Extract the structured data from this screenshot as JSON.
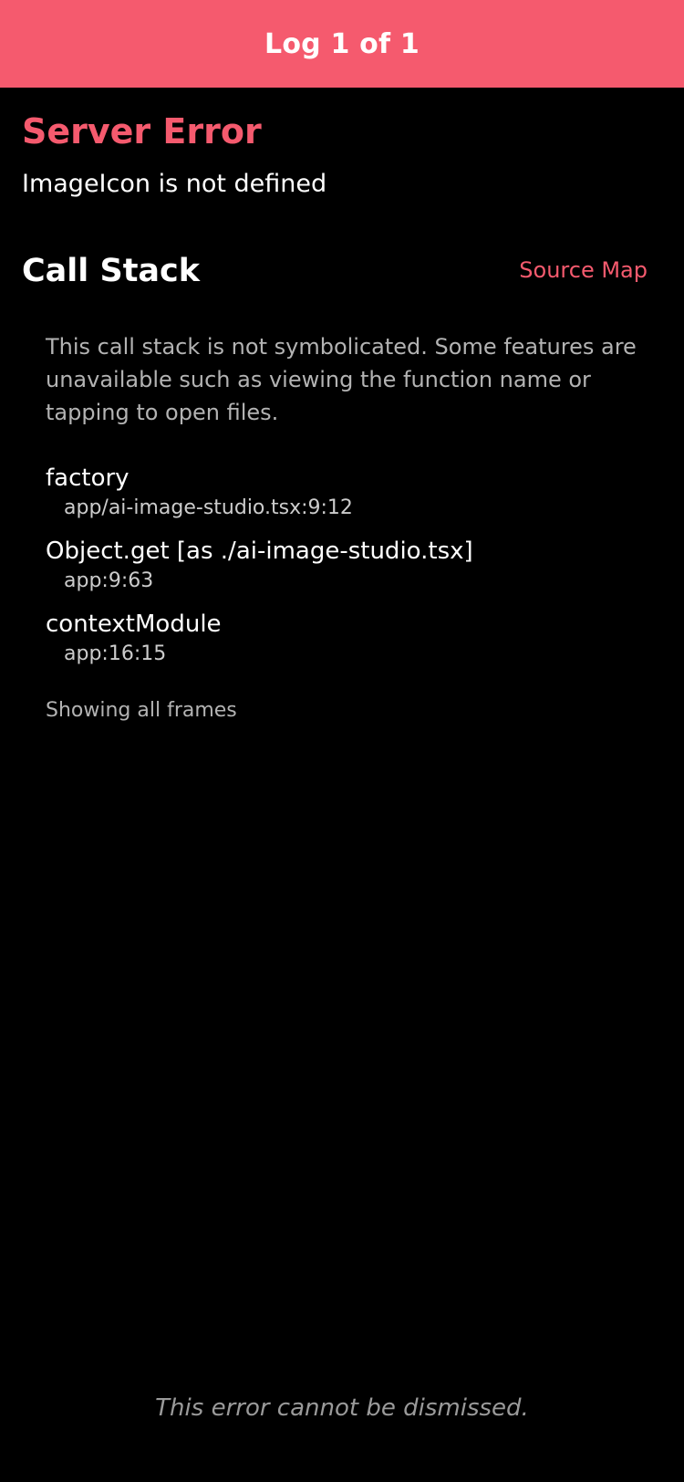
{
  "header": {
    "title": "Log 1 of 1",
    "background_color": "#F55A6E"
  },
  "error": {
    "title": "Server Error",
    "message": "ImageIcon is not defined",
    "accent_color": "#F55A6E"
  },
  "call_stack": {
    "heading": "Call Stack",
    "source_map_label": "Source Map",
    "note": "This call stack is not symbolicated. Some features are unavailable such as viewing the function name or tapping to open files.",
    "frames": [
      {
        "name": "factory",
        "location": "app/ai-image-studio.tsx:9:12"
      },
      {
        "name": "Object.get [as ./ai-image-studio.tsx]",
        "location": "app:9:63"
      },
      {
        "name": "contextModule",
        "location": "app:16:15"
      }
    ],
    "showing_all_label": "Showing all frames"
  },
  "footer": {
    "note": "This error cannot be dismissed."
  }
}
